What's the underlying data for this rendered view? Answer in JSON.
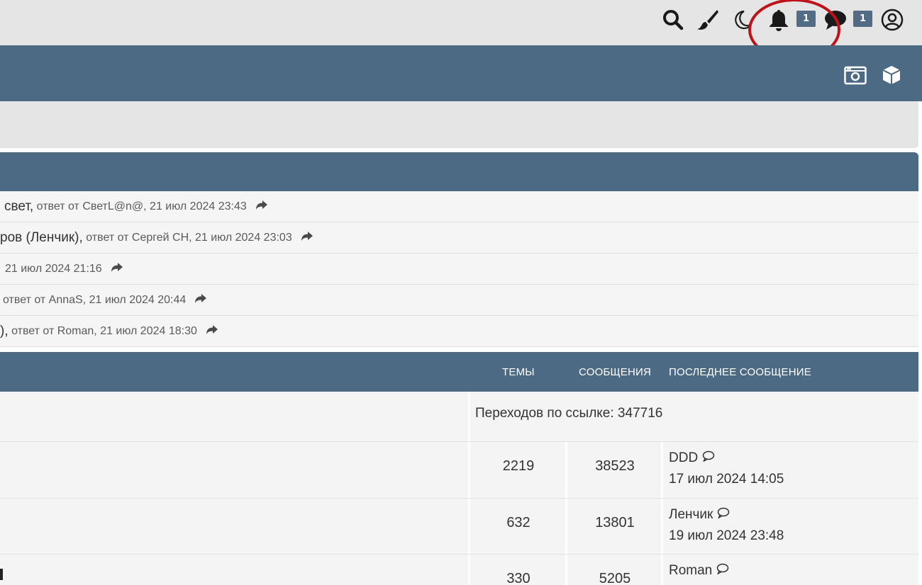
{
  "topbar": {
    "icons": [
      "search-icon",
      "brush-icon",
      "moon-icon",
      "bell-icon",
      "chat-icon",
      "user-icon"
    ],
    "notifications_count": "1",
    "messages_count": "1",
    "highlight_color": "#c0121a"
  },
  "navbar": {
    "icons": [
      "camera-icon",
      "cube-icon"
    ],
    "color": "#4d6a84"
  },
  "recent": [
    {
      "title": "свет,",
      "meta": "ответ от СветL@n@, 21 июл 2024 23:43"
    },
    {
      "title": "ров (Ленчик),",
      "meta": "ответ от Сергей СН, 21 июл 2024 23:03"
    },
    {
      "title": "",
      "meta": "21 июл 2024 21:16"
    },
    {
      "title": "",
      "meta": "ответ от AnnaS, 21 июл 2024 20:44"
    },
    {
      "title": "),",
      "meta": "ответ от Roman, 21 июл 2024 18:30"
    }
  ],
  "table": {
    "headers": {
      "topics": "ТЕМЫ",
      "posts": "СООБЩЕНИЯ",
      "last": "ПОСЛЕДНЕЕ СООБЩЕНИЕ"
    },
    "redirect_text": "Переходов по ссылке: 347716",
    "rows": [
      {
        "topics": "2219",
        "posts": "38523",
        "last_user": "DDD",
        "last_date": "17 июл 2024 14:05"
      },
      {
        "topics": "632",
        "posts": "13801",
        "last_user": "Ленчик",
        "last_date": "19 июл 2024 23:48"
      },
      {
        "topics": "330",
        "posts": "5205",
        "last_user": "Roman",
        "last_date": ""
      }
    ]
  }
}
